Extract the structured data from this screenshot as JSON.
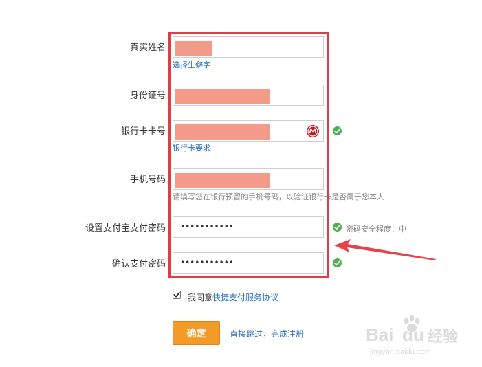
{
  "form": {
    "real_name": {
      "label": "真实姓名",
      "helper_link": "选择生僻字"
    },
    "id_number": {
      "label": "身份证号"
    },
    "bank_card": {
      "label": "银行卡卡号",
      "helper_link": "银行卡要求"
    },
    "phone": {
      "label": "手机号码",
      "helper_text": "请填写您在银行预留的手机号码，以验证银行卡是否属于您本人"
    },
    "pay_password": {
      "label": "设置支付宝支付密码",
      "value": "•••••••••••",
      "strength": "密码安全程度：中"
    },
    "confirm_password": {
      "label": "确认支付密码",
      "value": "•••••••••••"
    },
    "agreement": {
      "prefix": "我同意",
      "link": "快捷支付服务协议",
      "checked": true
    },
    "confirm_button": "确定",
    "skip_link": "直接跳过，完成注册"
  },
  "colors": {
    "redaction": "#f39b88",
    "highlight_frame": "#e03c45",
    "arrow": "#e8414a",
    "button": "#f49a26",
    "link": "#2a71b8",
    "success": "#4caf50"
  },
  "icons": {
    "bank": "china-merchants-bank-logo-icon",
    "valid": "check-circle-icon"
  },
  "watermark": {
    "brand": "Bai",
    "brand_mid": "du",
    "brand_cn": "经验",
    "url": "jingyan.baidu.com"
  }
}
